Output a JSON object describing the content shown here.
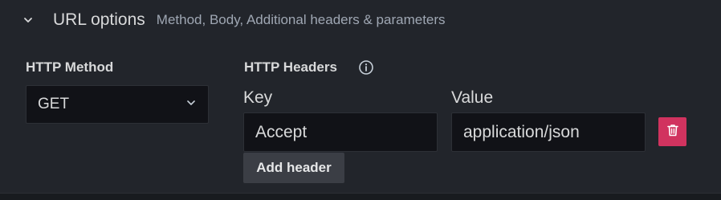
{
  "section": {
    "title": "URL options",
    "description": "Method, Body, Additional headers & parameters",
    "expanded": true
  },
  "method": {
    "label": "HTTP Method",
    "selected": "GET"
  },
  "headers": {
    "label": "HTTP Headers",
    "info_icon": "info-circle-icon",
    "key_label": "Key",
    "value_label": "Value",
    "rows": [
      {
        "key": "Accept",
        "value": "application/json"
      }
    ],
    "add_label": "Add header",
    "delete_color": "#d1335f"
  },
  "colors": {
    "panel_bg": "#22252b",
    "input_bg": "#111217",
    "text": "#d8d9da",
    "muted": "#9fa7b3"
  }
}
